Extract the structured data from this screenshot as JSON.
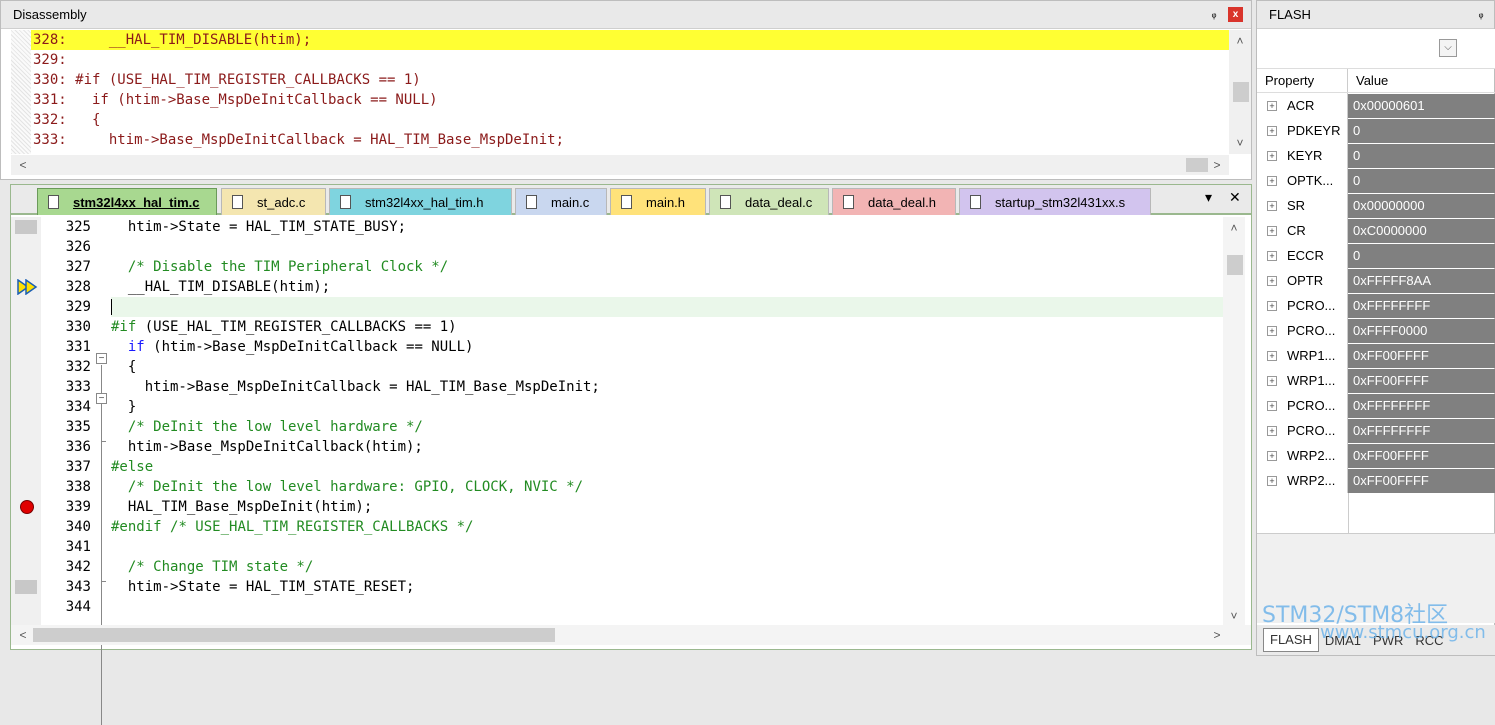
{
  "disassembly": {
    "title": "Disassembly",
    "pin": "ᵩ",
    "close": "x",
    "lines": [
      "328:     __HAL_TIM_DISABLE(htim);",
      "329: ",
      "330: #if (USE_HAL_TIM_REGISTER_CALLBACKS == 1)",
      "331:   if (htim->Base_MspDeInitCallback == NULL)",
      "332:   {",
      "333:     htim->Base_MspDeInitCallback = HAL_TIM_Base_MspDeInit;"
    ]
  },
  "editor": {
    "tabs": [
      {
        "label": "stm32l4xx_hal_tim.c",
        "bg": "#a8d890"
      },
      {
        "label": "st_adc.c",
        "bg": "#f4e6b0"
      },
      {
        "label": "stm32l4xx_hal_tim.h",
        "bg": "#7fd4df"
      },
      {
        "label": "main.c",
        "bg": "#c9d7ef"
      },
      {
        "label": "main.h",
        "bg": "#ffe27a"
      },
      {
        "label": "data_deal.c",
        "bg": "#cfe5b8"
      },
      {
        "label": "data_deal.h",
        "bg": "#f2b4b4"
      },
      {
        "label": "startup_stm32l431xx.s",
        "bg": "#d2c4ee"
      }
    ],
    "tab_menu": "▾",
    "tab_close": "✕",
    "line_numbers": [
      "325",
      "326",
      "327",
      "328",
      "329",
      "330",
      "331",
      "332",
      "333",
      "334",
      "335",
      "336",
      "337",
      "338",
      "339",
      "340",
      "341",
      "342",
      "343",
      "344"
    ],
    "code": [
      {
        "t": [
          [
            "",
            "  htim->State = HAL_TIM_STATE_BUSY;"
          ]
        ]
      },
      {
        "t": [
          [
            "",
            ""
          ]
        ]
      },
      {
        "t": [
          [
            "",
            "  "
          ],
          [
            "cm",
            "/* Disable the TIM Peripheral Clock */"
          ]
        ]
      },
      {
        "t": [
          [
            "",
            "  __HAL_TIM_DISABLE(htim);"
          ]
        ]
      },
      {
        "t": [
          [
            "",
            ""
          ]
        ],
        "cur": true
      },
      {
        "t": [
          [
            "pp",
            "#if"
          ],
          [
            "",
            " (USE_HAL_TIM_REGISTER_CALLBACKS == 1)"
          ]
        ]
      },
      {
        "t": [
          [
            "",
            "  "
          ],
          [
            "kw",
            "if"
          ],
          [
            "",
            " (htim->Base_MspDeInitCallback == NULL)"
          ]
        ]
      },
      {
        "t": [
          [
            "",
            "  {"
          ]
        ]
      },
      {
        "t": [
          [
            "",
            "    htim->Base_MspDeInitCallback = HAL_TIM_Base_MspDeInit;"
          ]
        ]
      },
      {
        "t": [
          [
            "",
            "  }"
          ]
        ]
      },
      {
        "t": [
          [
            "",
            "  "
          ],
          [
            "cm",
            "/* DeInit the low level hardware */"
          ]
        ]
      },
      {
        "t": [
          [
            "",
            "  htim->Base_MspDeInitCallback(htim);"
          ]
        ]
      },
      {
        "t": [
          [
            "pp",
            "#else"
          ]
        ]
      },
      {
        "t": [
          [
            "",
            "  "
          ],
          [
            "cm",
            "/* DeInit the low level hardware: GPIO, CLOCK, NVIC */"
          ]
        ]
      },
      {
        "t": [
          [
            "",
            "  HAL_TIM_Base_MspDeInit(htim);"
          ]
        ]
      },
      {
        "t": [
          [
            "pp",
            "#endif"
          ],
          [
            "",
            " "
          ],
          [
            "cm",
            "/* USE_HAL_TIM_REGISTER_CALLBACKS */"
          ]
        ]
      },
      {
        "t": [
          [
            "",
            ""
          ]
        ]
      },
      {
        "t": [
          [
            "",
            "  "
          ],
          [
            "cm",
            "/* Change TIM state */"
          ]
        ]
      },
      {
        "t": [
          [
            "",
            "  htim->State = HAL_TIM_STATE_RESET;"
          ]
        ]
      },
      {
        "t": [
          [
            "",
            ""
          ]
        ]
      }
    ]
  },
  "flash": {
    "title": "FLASH",
    "pin": "ᵩ",
    "header_property": "Property",
    "header_value": "Value",
    "registers": [
      {
        "name": "ACR",
        "value": "0x00000601"
      },
      {
        "name": "PDKEYR",
        "value": "0"
      },
      {
        "name": "KEYR",
        "value": "0"
      },
      {
        "name": "OPTK...",
        "value": "0"
      },
      {
        "name": "SR",
        "value": "0x00000000"
      },
      {
        "name": "CR",
        "value": "0xC0000000"
      },
      {
        "name": "ECCR",
        "value": "0"
      },
      {
        "name": "OPTR",
        "value": "0xFFFFF8AA"
      },
      {
        "name": "PCRO...",
        "value": "0xFFFFFFFF"
      },
      {
        "name": "PCRO...",
        "value": "0xFFFF0000"
      },
      {
        "name": "WRP1...",
        "value": "0xFF00FFFF"
      },
      {
        "name": "WRP1...",
        "value": "0xFF00FFFF"
      },
      {
        "name": "PCRO...",
        "value": "0xFFFFFFFF"
      },
      {
        "name": "PCRO...",
        "value": "0xFFFFFFFF"
      },
      {
        "name": "WRP2...",
        "value": "0xFF00FFFF"
      },
      {
        "name": "WRP2...",
        "value": "0xFF00FFFF"
      }
    ],
    "bottom_tabs": [
      "FLASH",
      "DMA1",
      "PWR",
      "RCC"
    ]
  },
  "watermark": {
    "line1": "STM32/STM8社区",
    "line2": "www.stmcu.org.cn"
  }
}
